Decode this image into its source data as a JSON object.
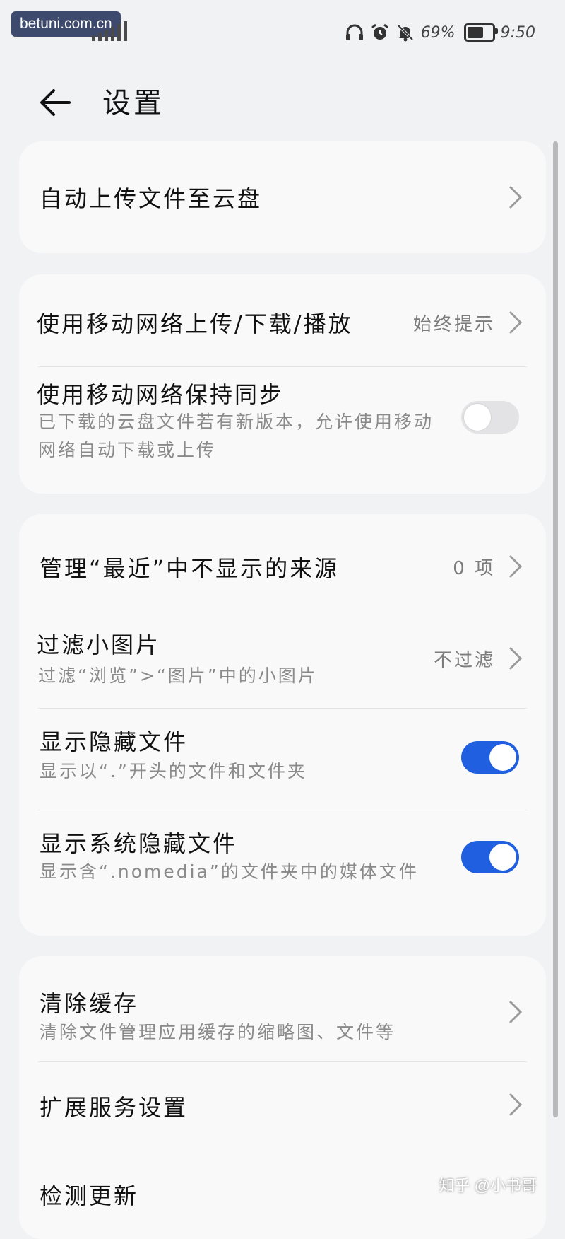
{
  "status_bar": {
    "site_badge": "betuni.com.cn",
    "battery_level": "69%",
    "battery_fraction": 0.69,
    "time": "9:50",
    "icons": [
      "signal-icon",
      "headphones-icon",
      "alarm-icon",
      "mute-bell-icon",
      "battery-icon"
    ]
  },
  "header": {
    "back_icon": "arrow-left-icon",
    "title": "设置"
  },
  "sections": {
    "auto_upload": {
      "title": "自动上传文件至云盘"
    },
    "mobile_transfer": {
      "title": "使用移动网络上传/下载/播放",
      "value": "始终提示"
    },
    "mobile_sync": {
      "title": "使用移动网络保持同步",
      "subtitle": "已下载的云盘文件若有新版本，允许使用移动网络自动下载或上传",
      "enabled": false
    },
    "recent_sources": {
      "title": "管理“最近”中不显示的来源",
      "value": "0 项"
    },
    "filter_images": {
      "title": "过滤小图片",
      "subtitle": "过滤“浏览”>“图片”中的小图片",
      "value": "不过滤"
    },
    "show_hidden": {
      "title": "显示隐藏文件",
      "subtitle": "显示以“.”开头的文件和文件夹",
      "enabled": true
    },
    "show_system_hidden": {
      "title": "显示系统隐藏文件",
      "subtitle": "显示含“.nomedia”的文件夹中的媒体文件",
      "enabled": true
    },
    "clear_cache": {
      "title": "清除缓存",
      "subtitle": "清除文件管理应用缓存的缩略图、文件等"
    },
    "extension_services": {
      "title": "扩展服务设置"
    },
    "check_update": {
      "title": "检测更新"
    }
  },
  "watermark": "知乎 @小书哥"
}
